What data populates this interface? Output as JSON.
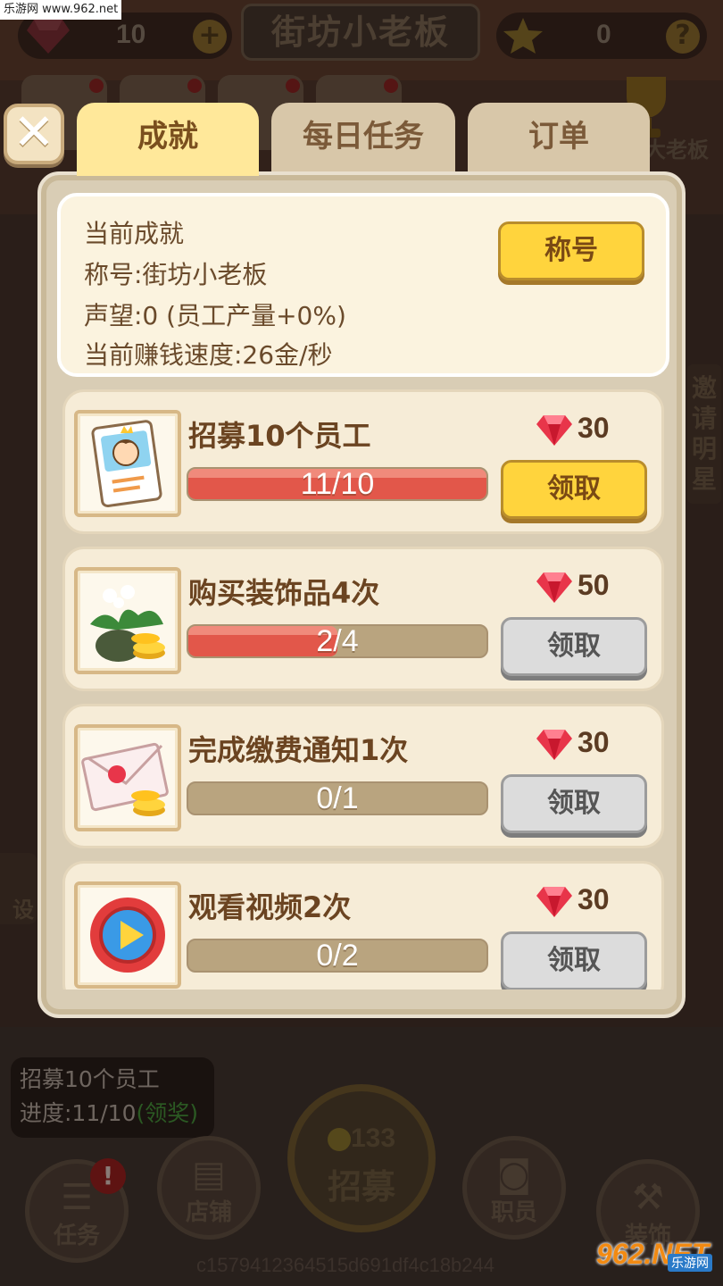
{
  "watermark": {
    "top_left": "乐游网 www.962.net",
    "bottom_right_big": "962.NET",
    "bottom_right_small": "乐游网"
  },
  "topbar": {
    "gems": "10",
    "shop_name": "街坊小老板",
    "stars": "0",
    "plus_glyph": "+",
    "help_glyph": "?"
  },
  "trophy_label": "大老板",
  "side": {
    "invite": "邀请明星",
    "settings": "设"
  },
  "tabs": [
    {
      "label": "成就",
      "active": true
    },
    {
      "label": "每日任务",
      "active": false
    },
    {
      "label": "订单",
      "active": false
    }
  ],
  "close_glyph": "✕",
  "summary": {
    "heading": "当前成就",
    "title_line": "称号:街坊小老板",
    "prestige_line": "声望:0 (员工产量+0%)",
    "speed_line": "当前赚钱速度:26金/秒",
    "title_button": "称号"
  },
  "achievements": [
    {
      "name": "招募10个员工",
      "progress": "11/10",
      "fill": 1.0,
      "reward": "30",
      "claim_label": "领取",
      "claimable": true,
      "icon": "recruit-card-icon"
    },
    {
      "name": "购买装饰品4次",
      "progress": "2/4",
      "fill": 0.5,
      "reward": "50",
      "claim_label": "领取",
      "claimable": false,
      "icon": "plant-coins-icon"
    },
    {
      "name": "完成缴费通知1次",
      "progress": "0/1",
      "fill": 0.0,
      "reward": "30",
      "claim_label": "领取",
      "claimable": false,
      "icon": "envelope-coins-icon"
    },
    {
      "name": "观看视频2次",
      "progress": "0/2",
      "fill": 0.0,
      "reward": "30",
      "claim_label": "领取",
      "claimable": false,
      "icon": "play-video-icon"
    }
  ],
  "task_tip": {
    "line1": "招募10个员工",
    "line2_prefix": "进度:11/10",
    "line2_claim": "(领奖)"
  },
  "bottom_nav": {
    "tasks": "任务",
    "tasks_badge": "!",
    "shop": "店铺",
    "recruit_cost": "133",
    "recruit": "招募",
    "staff": "职员",
    "decor": "装饰"
  },
  "device_hash": "c1579412364515d691df4c18b244",
  "colors": {
    "accent_yellow": "#ffd43d",
    "progress_red": "#e2574a",
    "panel": "#d9cdb5",
    "card": "#f6ecd7"
  }
}
